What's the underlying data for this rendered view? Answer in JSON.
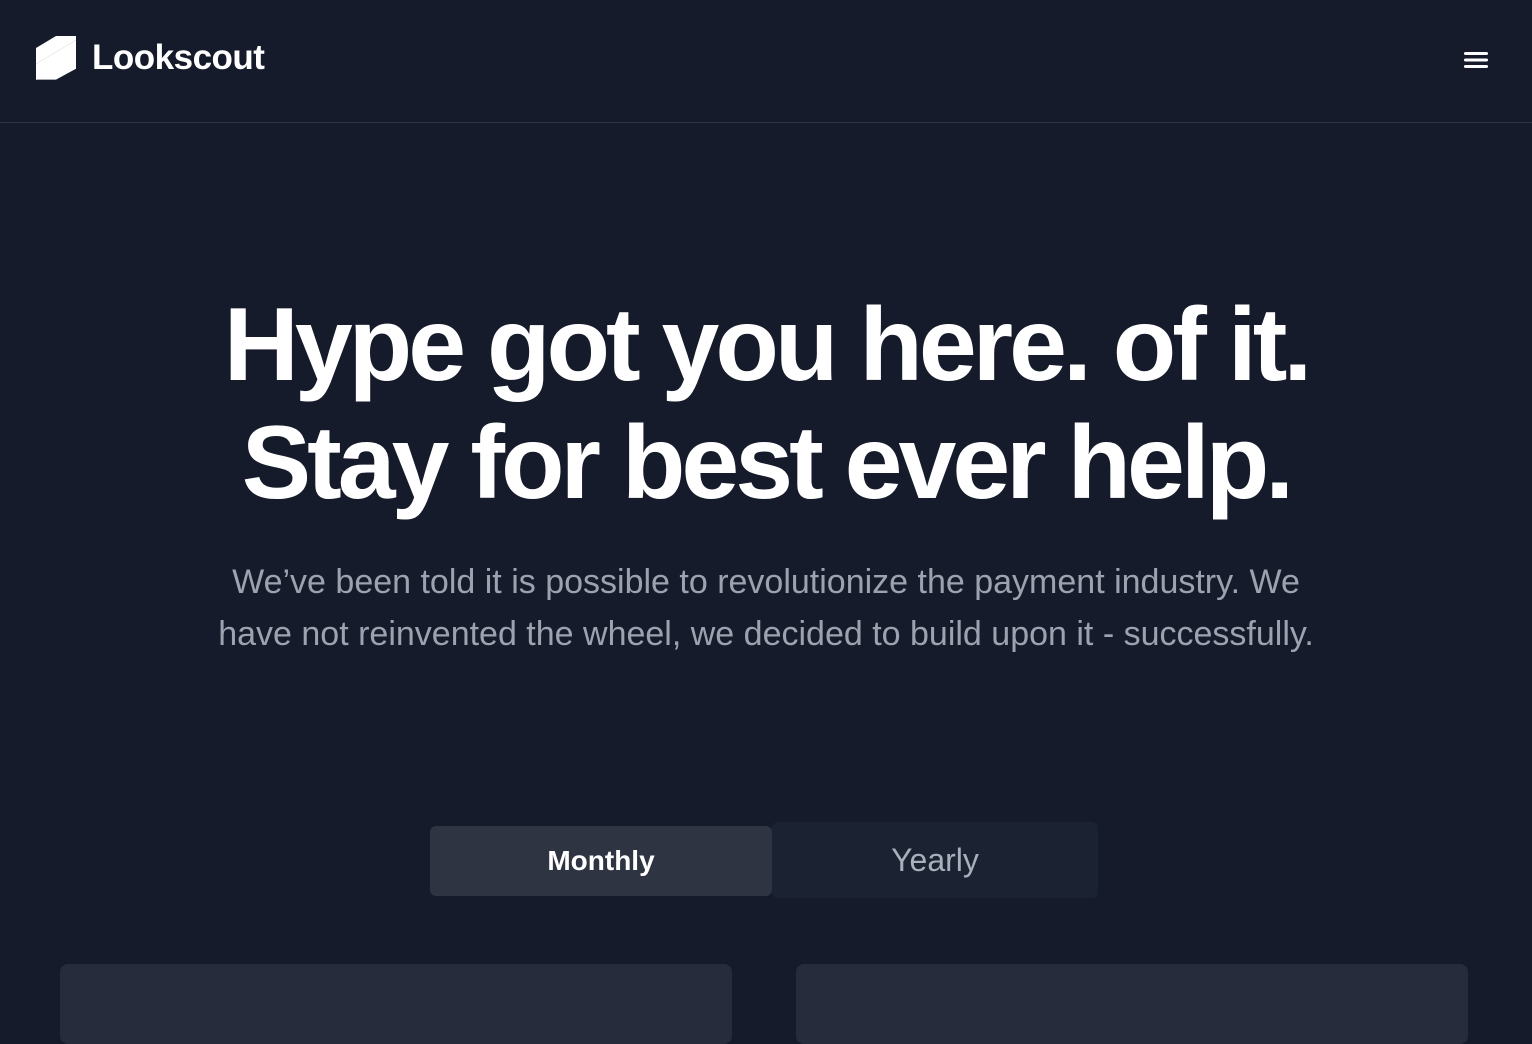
{
  "header": {
    "brand_name": "Lookscout",
    "logo_icon": "stacked-stripes-logo-icon",
    "menu_icon": "hamburger-menu-icon"
  },
  "hero": {
    "title_line1": "Hype got you here. of it.",
    "title_line2": "Stay for best ever help.",
    "subtitle_line1": "We’ve been told it is possible to revolutionize the payment industry. We",
    "subtitle_line2": "have not reinvented the wheel, we decided to build upon it - successfully."
  },
  "billing_toggle": {
    "monthly_label": "Monthly",
    "yearly_label": "Yearly",
    "selected": "Monthly"
  },
  "colors": {
    "background": "#161b2b",
    "header_border": "#2e3442",
    "active_toggle": "#2e3442",
    "inactive_toggle": "#1b2231",
    "card": "#262c3b",
    "subtitle_text": "#9ca3af"
  }
}
